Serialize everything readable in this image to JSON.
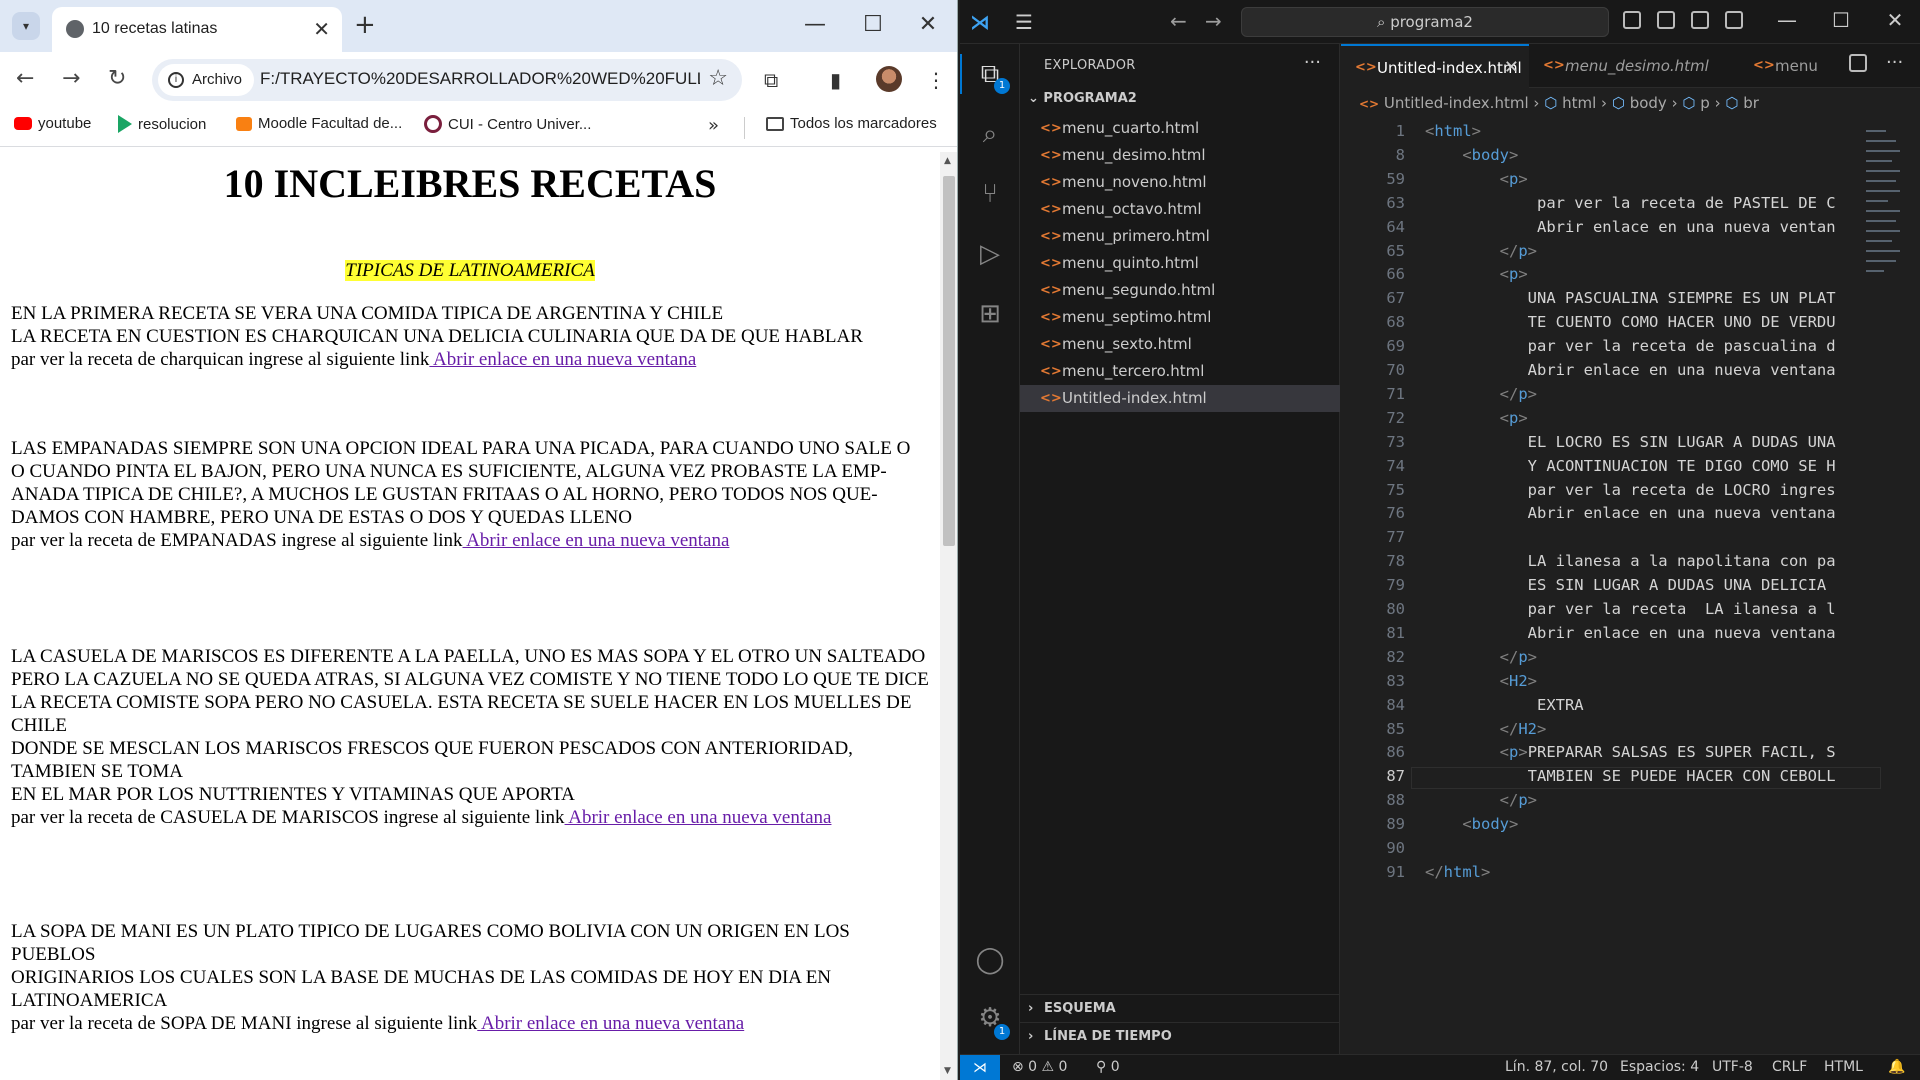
{
  "browser": {
    "tab_title": "10 recetas latinas",
    "security_chip": "Archivo",
    "url": "F:/TRAYECTO%20DESARROLLADOR%20WED%20FULL...",
    "bookmarks": [
      "youtube",
      "resolucion",
      "Moodle Facultad de...",
      "CUI - Centro Univer..."
    ],
    "all_bookmarks": "Todos los marcadores"
  },
  "page": {
    "title": "10 INCLEIBRES RECETAS",
    "subtitle": "TIPICAS DE LATINOAMERICA",
    "link_text": " Abrir enlace en una nueva ventana",
    "sections": [
      {
        "lines": [
          "EN LA PRIMERA RECETA SE VERA UNA COMIDA TIPICA DE ARGENTINA Y CHILE",
          "LA RECETA EN CUESTION ES CHARQUICAN UNA DELICIA CULINARIA QUE DA DE QUE HABLAR"
        ],
        "prompt": "par ver la receta de charquican ingrese al siguiente link"
      },
      {
        "lines": [
          "LAS EMPANADAS SIEMPRE SON UNA OPCION IDEAL PARA UNA PICADA, PARA CUANDO UNO SALE O",
          "O CUANDO PINTA EL BAJON, PERO UNA NUNCA ES SUFICIENTE, ALGUNA VEZ PROBASTE LA EMP-",
          "ANADA TIPICA DE CHILE?, A MUCHOS LE GUSTAN FRITAAS O AL HORNO, PERO TODOS NOS QUE-",
          "DAMOS CON HAMBRE, PERO UNA DE ESTAS O DOS Y QUEDAS LLENO"
        ],
        "prompt": "par ver la receta de EMPANADAS ingrese al siguiente link"
      },
      {
        "lines": [
          "LA CASUELA DE MARISCOS ES DIFERENTE A LA PAELLA, UNO ES MAS SOPA Y EL OTRO UN SALTEADO",
          "PERO LA CAZUELA NO SE QUEDA ATRAS, SI ALGUNA VEZ COMISTE Y NO TIENE TODO LO QUE TE DICE",
          "LA RECETA COMISTE SOPA PERO NO CASUELA. ESTA RECETA SE SUELE HACER EN LOS MUELLES DE CHILE",
          "DONDE SE MESCLAN LOS MARISCOS FRESCOS QUE FUERON PESCADOS CON ANTERIORIDAD, TAMBIEN SE TOMA",
          "EN EL MAR POR LOS NUTTRIENTES Y VITAMINAS QUE APORTA"
        ],
        "prompt": "par ver la receta de CASUELA DE MARISCOS ingrese al siguiente link"
      },
      {
        "lines": [
          "LA SOPA DE MANI ES UN PLATO TIPICO DE LUGARES COMO BOLIVIA CON UN ORIGEN EN LOS PUEBLOS",
          "ORIGINARIOS LOS CUALES SON LA BASE DE MUCHAS DE LAS COMIDAS DE HOY EN DIA EN LATINOAMERICA"
        ],
        "prompt": "par ver la receta de SOPA DE MANI ingrese al siguiente link"
      }
    ]
  },
  "vscode": {
    "search": "programa2",
    "explorer_title": "EXPLORADOR",
    "folder": "PROGRAMA2",
    "files": [
      "menu_cuarto.html",
      "menu_desimo.html",
      "menu_noveno.html",
      "menu_octavo.html",
      "menu_primero.html",
      "menu_quinto.html",
      "menu_segundo.html",
      "menu_septimo.html",
      "menu_sexto.html",
      "menu_tercero.html",
      "Untitled-index.html"
    ],
    "outline": "ESQUEMA",
    "timeline": "LÍNEA DE TIEMPO",
    "tabs": [
      "Untitled-index.html",
      "menu_desimo.html",
      "menu"
    ],
    "breadcrumbs": [
      "Untitled-index.html",
      "html",
      "body",
      "p",
      "br"
    ],
    "code_lines": [
      {
        "n": "1",
        "t": "<html>"
      },
      {
        "n": "8",
        "t": "    <body>"
      },
      {
        "n": "59",
        "t": "        <p>"
      },
      {
        "n": "63",
        "t": "            par ver la receta de PASTEL DE C"
      },
      {
        "n": "64",
        "t": "            Abrir enlace en una nueva ventan"
      },
      {
        "n": "65",
        "t": "        </p>"
      },
      {
        "n": "66",
        "t": "        <p>"
      },
      {
        "n": "67",
        "t": "           UNA PASCUALINA SIEMPRE ES UN PLAT"
      },
      {
        "n": "68",
        "t": "           TE CUENTO COMO HACER UNO DE VERDU"
      },
      {
        "n": "69",
        "t": "           par ver la receta de pascualina d"
      },
      {
        "n": "70",
        "t": "           Abrir enlace en una nueva ventana"
      },
      {
        "n": "71",
        "t": "        </p>"
      },
      {
        "n": "72",
        "t": "        <p>"
      },
      {
        "n": "73",
        "t": "           EL LOCRO ES SIN LUGAR A DUDAS UNA"
      },
      {
        "n": "74",
        "t": "           Y ACONTINUACION TE DIGO COMO SE H"
      },
      {
        "n": "75",
        "t": "           par ver la receta de LOCRO ingres"
      },
      {
        "n": "76",
        "t": "           Abrir enlace en una nueva ventana"
      },
      {
        "n": "77",
        "t": ""
      },
      {
        "n": "78",
        "t": "           LA ilanesa a la napolitana con pa"
      },
      {
        "n": "79",
        "t": "           ES SIN LUGAR A DUDAS UNA DELICIA "
      },
      {
        "n": "80",
        "t": "           par ver la receta  LA ilanesa a l"
      },
      {
        "n": "81",
        "t": "           Abrir enlace en una nueva ventana"
      },
      {
        "n": "82",
        "t": "        </p>"
      },
      {
        "n": "83",
        "t": "        <H2>"
      },
      {
        "n": "84",
        "t": "            EXTRA"
      },
      {
        "n": "85",
        "t": "        </H2>"
      },
      {
        "n": "86",
        "t": "        <p>PREPARAR SALSAS ES SUPER FACIL, S"
      },
      {
        "n": "87",
        "t": "           TAMBIEN SE PUEDE HACER CON CEBOLL"
      },
      {
        "n": "88",
        "t": "        </p>"
      },
      {
        "n": "89",
        "t": "    <body>"
      },
      {
        "n": "90",
        "t": ""
      },
      {
        "n": "91",
        "t": "</html>"
      }
    ],
    "status": {
      "problems": "⊗ 0 ⚠ 0",
      "ports": "⚲ 0",
      "position": "Lín. 87, col. 70",
      "spaces": "Espacios: 4",
      "encoding": "UTF-8",
      "eol": "CRLF",
      "language": "HTML"
    },
    "badge_count": "1"
  }
}
